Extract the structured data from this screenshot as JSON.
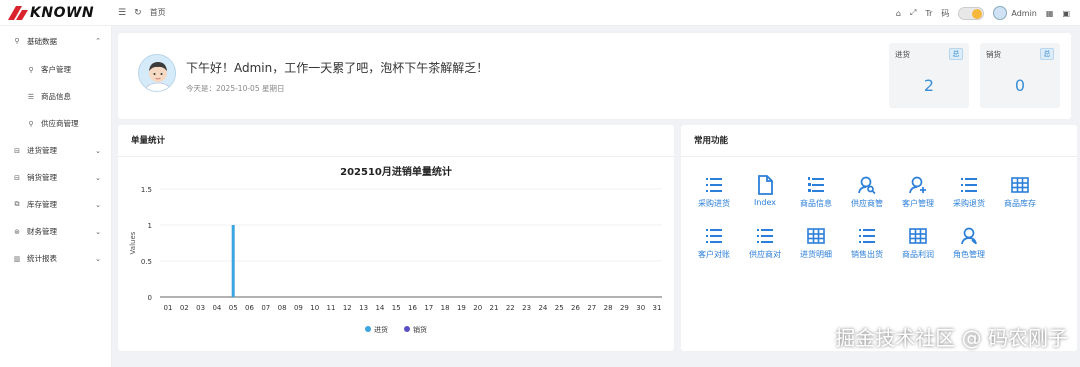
{
  "header": {
    "logo_text": "KNOWN",
    "menu_icon": "menu-icon",
    "refresh_icon": "refresh-icon",
    "breadcrumb": "首页",
    "right": {
      "home_icon": "home-icon",
      "fullscreen_icon": "fullscreen-icon",
      "font_size_label": "Tr",
      "layout_label": "码",
      "username": "Admin",
      "accent": "#f5b83d"
    }
  },
  "sidebar": {
    "items": [
      {
        "label": "基础数据",
        "icon": "user-icon",
        "expanded": true
      },
      {
        "label": "客户管理",
        "icon": "customer-icon"
      },
      {
        "label": "商品信息",
        "icon": "list-icon"
      },
      {
        "label": "供应商管理",
        "icon": "supplier-icon"
      },
      {
        "label": "进货管理",
        "icon": "inbox-icon"
      },
      {
        "label": "销货管理",
        "icon": "outbox-icon"
      },
      {
        "label": "库存管理",
        "icon": "stock-icon"
      },
      {
        "label": "财务管理",
        "icon": "finance-icon"
      },
      {
        "label": "统计报表",
        "icon": "chart-icon"
      }
    ]
  },
  "welcome": {
    "greeting": "下午好！Admin，工作一天累了吧，泡杯下午茶解解乏！",
    "date_text": "今天是：2025-10-05 星期日",
    "stats": [
      {
        "title": "进货",
        "value": "2"
      },
      {
        "title": "销货",
        "value": "0"
      }
    ]
  },
  "chart_card": {
    "title": "单量统计"
  },
  "chart_data": {
    "type": "bar",
    "title": "202510月进销单量统计",
    "xlabel": "",
    "ylabel": "Values",
    "ylim": [
      0,
      1.5
    ],
    "yticks": [
      "0",
      "0.5",
      "1",
      "1.5"
    ],
    "categories": [
      "01",
      "02",
      "03",
      "04",
      "05",
      "06",
      "07",
      "08",
      "09",
      "10",
      "11",
      "12",
      "13",
      "14",
      "15",
      "16",
      "17",
      "18",
      "19",
      "20",
      "21",
      "22",
      "23",
      "24",
      "25",
      "26",
      "27",
      "28",
      "29",
      "30",
      "31"
    ],
    "series": [
      {
        "name": "进货",
        "color": "#3aa5e0",
        "values": [
          0,
          0,
          0,
          0,
          1,
          0,
          0,
          0,
          0,
          0,
          0,
          0,
          0,
          0,
          0,
          0,
          0,
          0,
          0,
          0,
          0,
          0,
          0,
          0,
          0,
          0,
          0,
          0,
          0,
          0,
          0
        ]
      },
      {
        "name": "销货",
        "color": "#5a4fc7",
        "values": [
          0,
          0,
          0,
          0,
          0,
          0,
          0,
          0,
          0,
          0,
          0,
          0,
          0,
          0,
          0,
          0,
          0,
          0,
          0,
          0,
          0,
          0,
          0,
          0,
          0,
          0,
          0,
          0,
          0,
          0,
          0
        ]
      }
    ],
    "legend_position": "bottom",
    "grid": true
  },
  "functions": {
    "title": "常用功能",
    "items": [
      {
        "label": "采购进货",
        "icon": "list-icon"
      },
      {
        "label": "Index",
        "icon": "document-icon"
      },
      {
        "label": "商品信息",
        "icon": "ordered-list-icon"
      },
      {
        "label": "供应商管",
        "icon": "user-search-icon"
      },
      {
        "label": "客户管理",
        "icon": "user-add-icon"
      },
      {
        "label": "采购退货",
        "icon": "list-icon"
      },
      {
        "label": "商品库存",
        "icon": "table-icon"
      },
      {
        "label": "客户对账",
        "icon": "list-icon"
      },
      {
        "label": "供应商对",
        "icon": "list-icon"
      },
      {
        "label": "进货明细",
        "icon": "table-icon"
      },
      {
        "label": "销售出货",
        "icon": "list-icon"
      },
      {
        "label": "商品利润",
        "icon": "table-icon"
      },
      {
        "label": "角色管理",
        "icon": "users-icon"
      }
    ]
  },
  "watermark": "掘金技术社区 @ 码农刚子"
}
